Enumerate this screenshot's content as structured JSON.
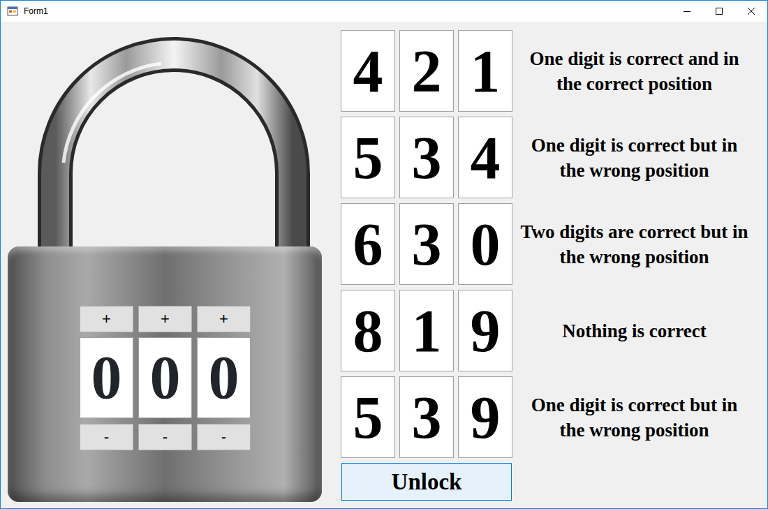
{
  "window": {
    "title": "Form1"
  },
  "lock": {
    "dials": [
      {
        "plus": "+",
        "digit": "0",
        "minus": "-"
      },
      {
        "plus": "+",
        "digit": "0",
        "minus": "-"
      },
      {
        "plus": "+",
        "digit": "0",
        "minus": "-"
      }
    ]
  },
  "clues": [
    {
      "digits": [
        "4",
        "2",
        "1"
      ],
      "hint": "One digit is correct and in the correct position"
    },
    {
      "digits": [
        "5",
        "3",
        "4"
      ],
      "hint": "One digit is correct but in the wrong position"
    },
    {
      "digits": [
        "6",
        "3",
        "0"
      ],
      "hint": "Two digits are correct but in the wrong position"
    },
    {
      "digits": [
        "8",
        "1",
        "9"
      ],
      "hint": "Nothing is correct"
    },
    {
      "digits": [
        "5",
        "3",
        "9"
      ],
      "hint": "One digit is correct but in the wrong position"
    }
  ],
  "unlock_button": "Unlock"
}
